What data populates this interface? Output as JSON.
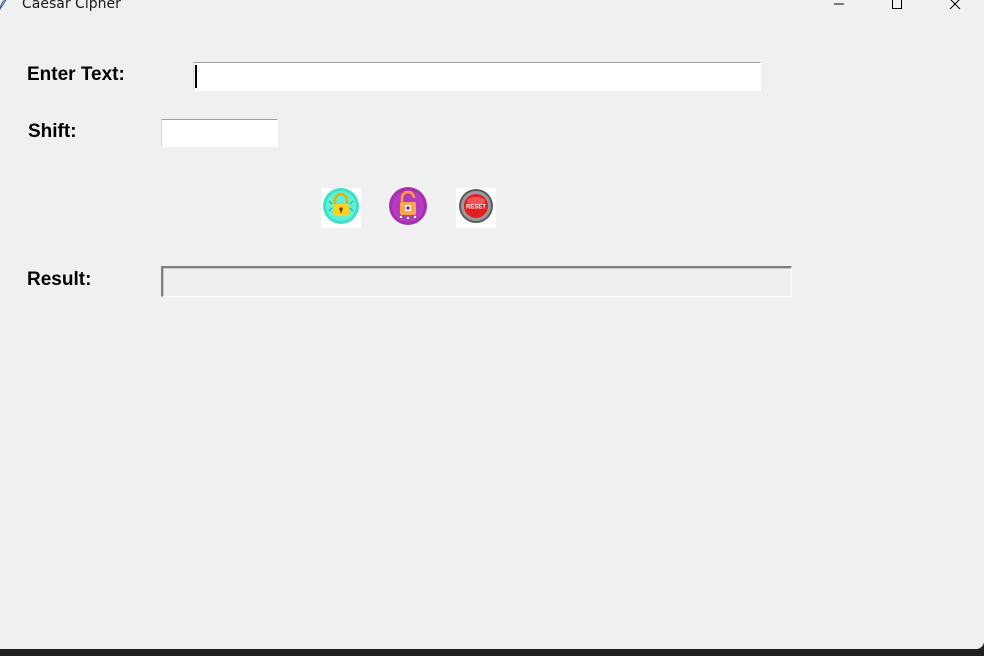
{
  "window": {
    "title": "Caesar Cipher",
    "icon": "feather-icon",
    "controls": [
      "minimize-icon",
      "maximize-icon",
      "close-icon"
    ]
  },
  "form": {
    "text_label": "Enter Text:",
    "text_value": "",
    "shift_label": "Shift:",
    "shift_value": "",
    "result_label": "Result:",
    "result_value": ""
  },
  "buttons": {
    "encrypt": {
      "icon": "lock-icon",
      "color": "#3ee0c8"
    },
    "decrypt": {
      "icon": "unlock-icon",
      "color": "#a62fb0"
    },
    "reset": {
      "icon": "reset-icon",
      "color": "#e02020",
      "label": "RESET"
    }
  }
}
